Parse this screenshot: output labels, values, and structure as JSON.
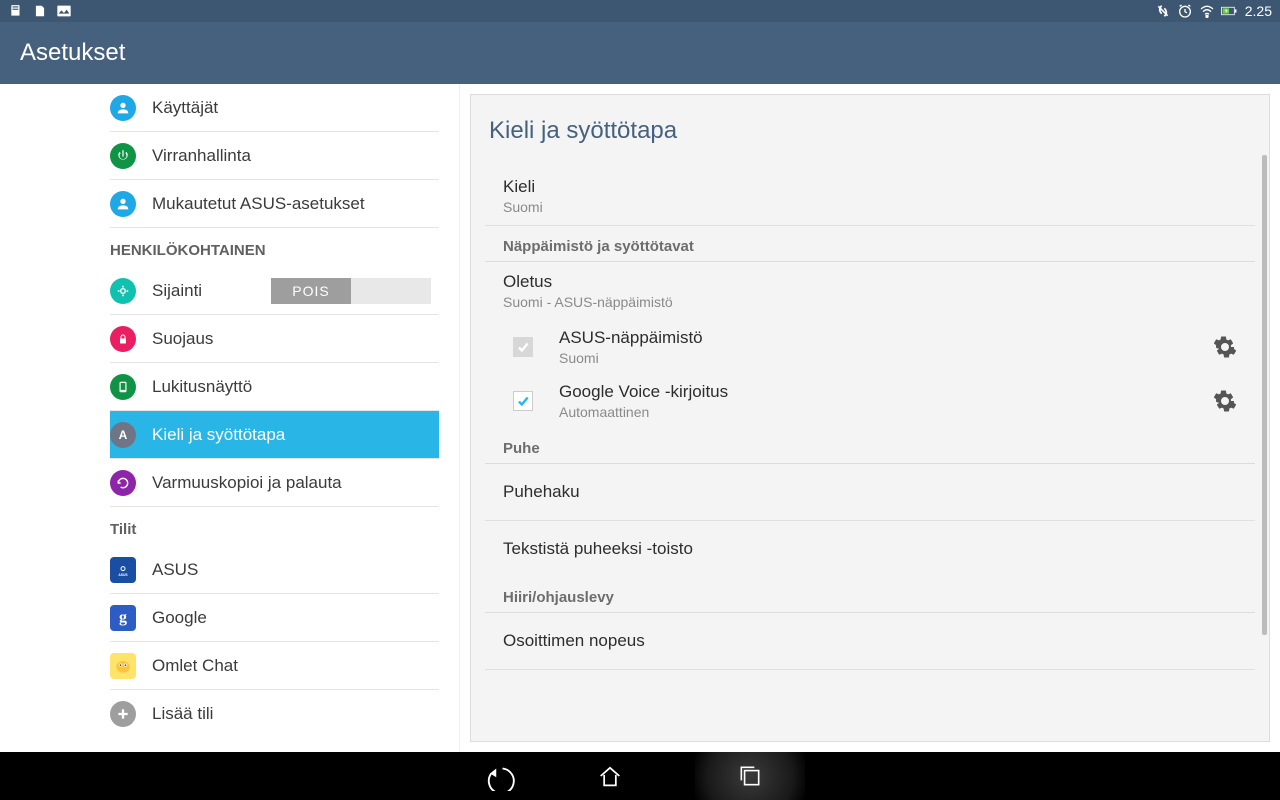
{
  "statusbar": {
    "time": "2.25"
  },
  "header": {
    "title": "Asetukset"
  },
  "sidebar": {
    "items": [
      {
        "label": "Käyttäjät",
        "icon_color": "#1ea8e6"
      },
      {
        "label": "Virranhallinta",
        "icon_color": "#0e9444"
      },
      {
        "label": "Mukautetut ASUS-asetukset",
        "icon_color": "#1ea8e6"
      }
    ],
    "section_personal": "HENKILÖKOHTAINEN",
    "items_personal": [
      {
        "label": "Sijainti",
        "icon_color": "#11c1af",
        "toggle": "POIS"
      },
      {
        "label": "Suojaus",
        "icon_color": "#ea1e63"
      },
      {
        "label": "Lukitusnäyttö",
        "icon_color": "#0e9444"
      },
      {
        "label": "Kieli ja syöttötapa",
        "icon_color": "#707585",
        "selected": true
      },
      {
        "label": "Varmuuskopioi ja palauta",
        "icon_color": "#8e24aa"
      }
    ],
    "section_accounts": "Tilit",
    "items_accounts": [
      {
        "label": "ASUS",
        "icon_color": "#1a4ea3"
      },
      {
        "label": "Google",
        "icon_color": "#2c5cc4"
      },
      {
        "label": "Omlet Chat",
        "icon_color": "#ffc107"
      },
      {
        "label": "Lisää tili",
        "icon_color": "#9e9e9e"
      }
    ]
  },
  "panel": {
    "title": "Kieli ja syöttötapa",
    "language": {
      "label": "Kieli",
      "value": "Suomi"
    },
    "section_keyboards": "Näppäimistö ja syöttötavat",
    "default": {
      "label": "Oletus",
      "value": "Suomi - ASUS-näppäimistö"
    },
    "keyboards": [
      {
        "name": "ASUS-näppäimistö",
        "sub": "Suomi",
        "checked": true,
        "disabled": true
      },
      {
        "name": "Google Voice -kirjoitus",
        "sub": "Automaattinen",
        "checked": true,
        "disabled": false
      }
    ],
    "section_speech": "Puhe",
    "voice_search": "Puhehaku",
    "tts": "Tekstistä puheeksi -toisto",
    "section_mouse": "Hiiri/ohjauslevy",
    "pointer_speed": "Osoittimen nopeus"
  }
}
